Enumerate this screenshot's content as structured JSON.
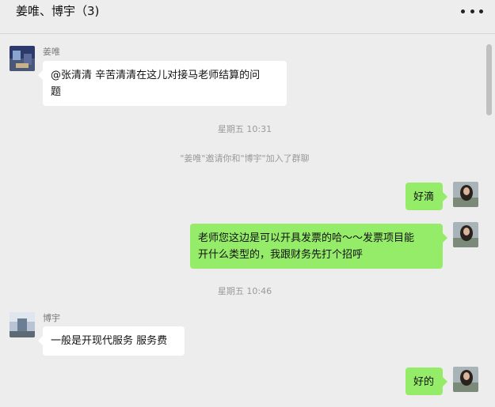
{
  "chat": {
    "title": "姜唯、博宇（3)"
  },
  "icons": {
    "more": "more-horizontal-icon",
    "avatar_jiang": "avatar-image",
    "avatar_self": "avatar-image",
    "avatar_boyu": "avatar-image"
  },
  "colors": {
    "background": "#ededed",
    "bubble_self": "#95ec69",
    "bubble_other": "#ffffff",
    "meta_text": "#9a9a9a"
  },
  "messages": {
    "m1": {
      "sender": "姜唯",
      "line1": "@张清清 辛苦清清在这儿对接马老师结算的问",
      "line2": "题"
    },
    "t1": "星期五 10:31",
    "sys1": "\"姜唯\"邀请你和\"博宇\"加入了群聊",
    "m2": {
      "text": "好滴"
    },
    "m3": {
      "line1": "老师您这边是可以开具发票的哈～～发票项目能",
      "line2": "开什么类型的，我跟财务先打个招呼"
    },
    "t2": "星期五 10:46",
    "m4": {
      "sender": "博宇",
      "text": "一般是开现代服务 服务费"
    },
    "m5": {
      "text": "好的"
    }
  }
}
